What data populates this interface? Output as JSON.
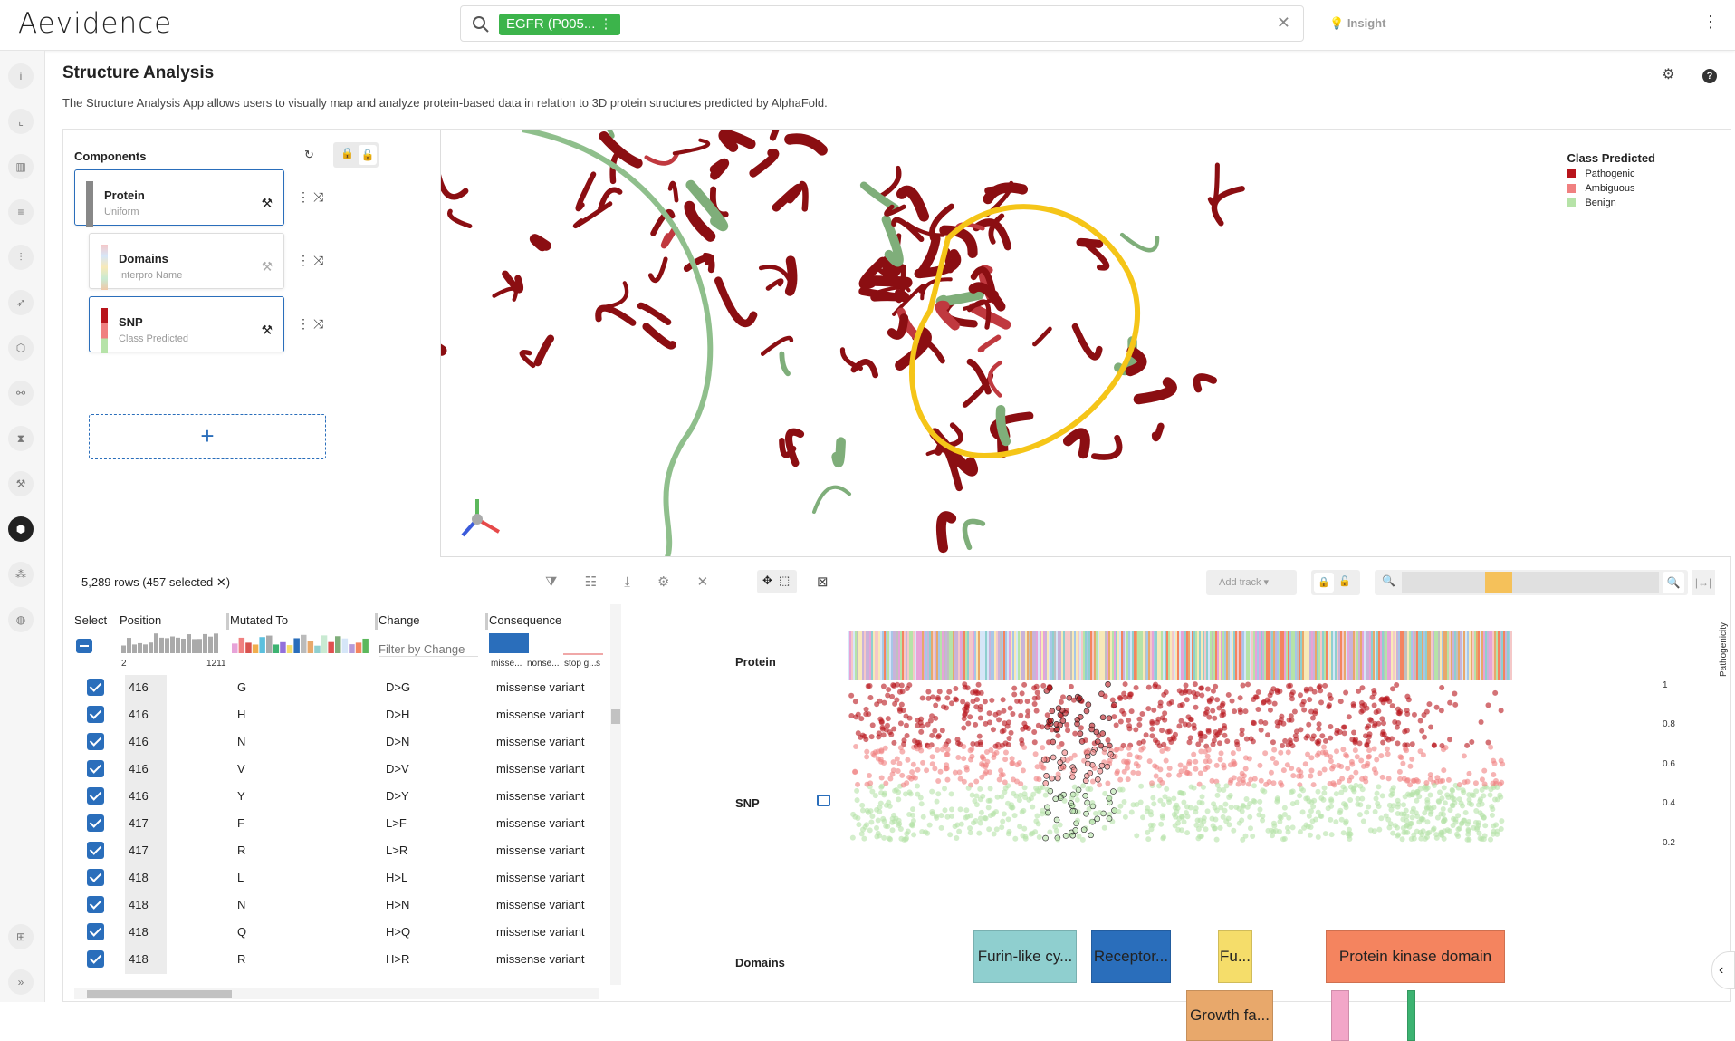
{
  "app": {
    "logo": "Aevidence",
    "search_chip": "EGFR (P005...",
    "insight": "Insight"
  },
  "page": {
    "title": "Structure Analysis",
    "description": "The Structure Analysis App allows users to visually map and analyze protein-based data in relation to 3D protein structures predicted by AlphaFold."
  },
  "components": {
    "title": "Components",
    "cards": [
      {
        "name": "Protein",
        "sub": "Uniform"
      },
      {
        "name": "Domains",
        "sub": "Interpro Name"
      },
      {
        "name": "SNP",
        "sub": "Class Predicted"
      }
    ],
    "add_label": "+"
  },
  "legend": {
    "title": "Class Predicted",
    "items": [
      {
        "label": "Pathogenic",
        "color": "#b8141b"
      },
      {
        "label": "Ambiguous",
        "color": "#f08080"
      },
      {
        "label": "Benign",
        "color": "#b6e3a8"
      }
    ]
  },
  "table": {
    "row_count": "5,289 rows (457 selected ✕)",
    "columns": [
      "Select",
      "Position",
      "Mutated To",
      "Change",
      "Consequence"
    ],
    "position_range": [
      "2",
      "1211"
    ],
    "change_filter_placeholder": "Filter by Change",
    "consequence_hist_labels": [
      "misse...",
      "nonse...",
      "stop g...",
      "s"
    ],
    "rows": [
      {
        "pos": "416",
        "mut": "G",
        "change": "D>G",
        "cons": "missense variant"
      },
      {
        "pos": "416",
        "mut": "H",
        "change": "D>H",
        "cons": "missense variant"
      },
      {
        "pos": "416",
        "mut": "N",
        "change": "D>N",
        "cons": "missense variant"
      },
      {
        "pos": "416",
        "mut": "V",
        "change": "D>V",
        "cons": "missense variant"
      },
      {
        "pos": "416",
        "mut": "Y",
        "change": "D>Y",
        "cons": "missense variant"
      },
      {
        "pos": "417",
        "mut": "F",
        "change": "L>F",
        "cons": "missense variant"
      },
      {
        "pos": "417",
        "mut": "R",
        "change": "L>R",
        "cons": "missense variant"
      },
      {
        "pos": "418",
        "mut": "L",
        "change": "H>L",
        "cons": "missense variant"
      },
      {
        "pos": "418",
        "mut": "N",
        "change": "H>N",
        "cons": "missense variant"
      },
      {
        "pos": "418",
        "mut": "Q",
        "change": "H>Q",
        "cons": "missense variant"
      },
      {
        "pos": "418",
        "mut": "R",
        "change": "H>R",
        "cons": "missense variant"
      }
    ]
  },
  "tracks": {
    "labels": {
      "protein": "Protein",
      "snp": "SNP",
      "domains": "Domains"
    },
    "add_track": "Add track",
    "y_axis_label": "Pathogenicity",
    "y_ticks": [
      "1",
      "0.8",
      "0.6",
      "0.4",
      "0.2"
    ],
    "domains": [
      {
        "label": "Furin-like cy...",
        "color": "#8fcfcf"
      },
      {
        "label": "Receptor...",
        "color": "#2a6ebb"
      },
      {
        "label": "Fu...",
        "color": "#f5dd6a"
      },
      {
        "label": "Protein kinase domain",
        "color": "#f4845f"
      },
      {
        "label": "Growth fa...",
        "color": "#e8a86b"
      },
      {
        "label": "",
        "color": "#f2a6c8"
      },
      {
        "label": "",
        "color": "#3cb371"
      }
    ]
  }
}
